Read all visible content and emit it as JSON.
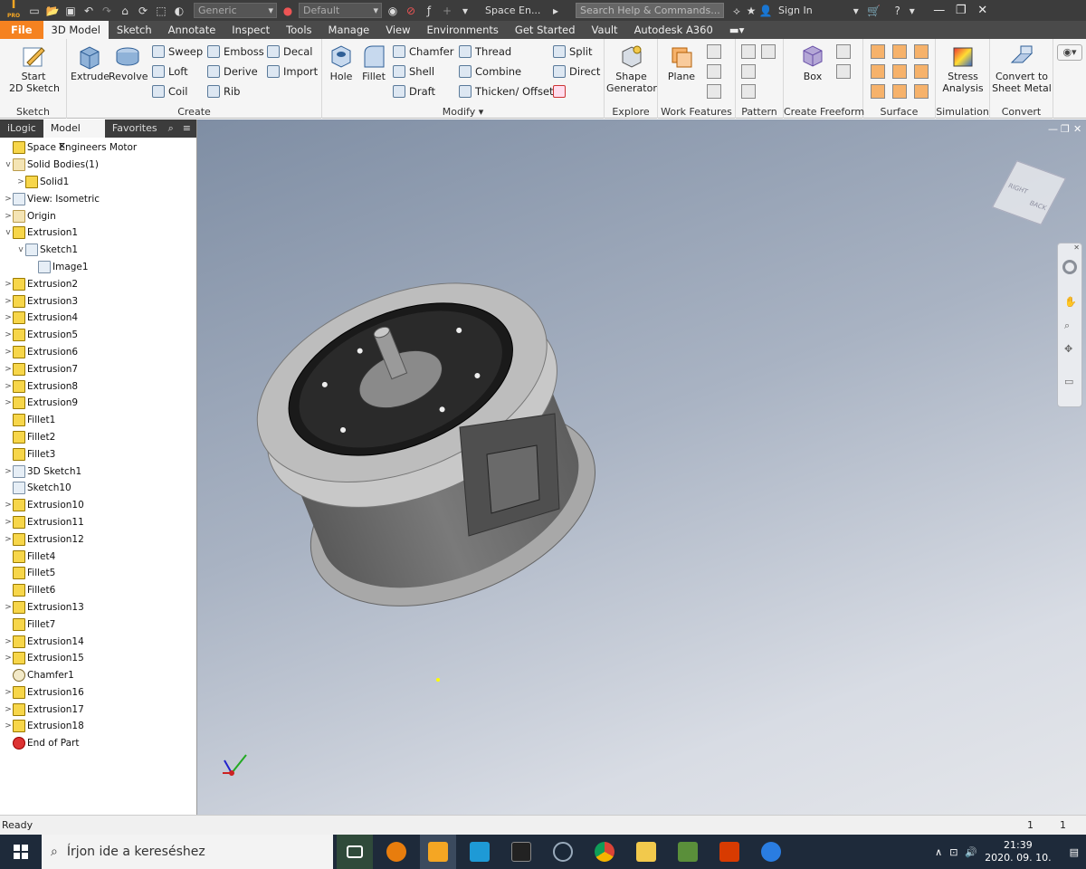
{
  "titlebar": {
    "app_badge": "PRO",
    "material_value": "Generic",
    "appearance_value": "Default",
    "doc_title": "Space En...",
    "search_placeholder": "Search Help & Commands...",
    "signin": "Sign In"
  },
  "tabs": [
    "File",
    "3D Model",
    "Sketch",
    "Annotate",
    "Inspect",
    "Tools",
    "Manage",
    "View",
    "Environments",
    "Get Started",
    "Vault",
    "Autodesk A360"
  ],
  "active_tab": "3D Model",
  "ribbon": {
    "sketch": {
      "title": "Sketch",
      "start_line1": "Start",
      "start_line2": "2D Sketch"
    },
    "create": {
      "title": "Create",
      "extrude": "Extrude",
      "revolve": "Revolve",
      "sweep": "Sweep",
      "loft": "Loft",
      "coil": "Coil",
      "emboss": "Emboss",
      "derive": "Derive",
      "rib": "Rib",
      "decal": "Decal",
      "import": "Import"
    },
    "modify": {
      "title": "Modify",
      "hole": "Hole",
      "fillet": "Fillet",
      "chamfer": "Chamfer",
      "shell": "Shell",
      "draft": "Draft",
      "thread": "Thread",
      "combine": "Combine",
      "thicken": "Thicken/ Offset",
      "split": "Split",
      "direct": "Direct"
    },
    "explore": {
      "title": "Explore",
      "shape_line1": "Shape",
      "shape_line2": "Generator"
    },
    "work": {
      "title": "Work Features",
      "plane": "Plane"
    },
    "pattern": {
      "title": "Pattern"
    },
    "freeform": {
      "title": "Create Freeform",
      "box": "Box"
    },
    "surface": {
      "title": "Surface"
    },
    "simulation": {
      "title": "Simulation",
      "stress_line1": "Stress",
      "stress_line2": "Analysis"
    },
    "convert": {
      "title": "Convert",
      "sm_line1": "Convert to",
      "sm_line2": "Sheet Metal"
    }
  },
  "browser": {
    "tabs": [
      "iLogic",
      "Model",
      "Favorites"
    ],
    "tree": [
      {
        "label": "Space Engineers Motor",
        "indent": 0,
        "exp": "",
        "icon": "part"
      },
      {
        "label": "Solid Bodies(1)",
        "indent": 0,
        "exp": "v",
        "icon": "fold"
      },
      {
        "label": "Solid1",
        "indent": 1,
        "exp": ">",
        "icon": "part"
      },
      {
        "label": "View: Isometric",
        "indent": 0,
        "exp": ">",
        "icon": "sk"
      },
      {
        "label": "Origin",
        "indent": 0,
        "exp": ">",
        "icon": "fold"
      },
      {
        "label": "Extrusion1",
        "indent": 0,
        "exp": "v",
        "icon": "part"
      },
      {
        "label": "Sketch1",
        "indent": 1,
        "exp": "v",
        "icon": "sk"
      },
      {
        "label": "Image1",
        "indent": 2,
        "exp": "",
        "icon": "sk"
      },
      {
        "label": "Extrusion2",
        "indent": 0,
        "exp": ">",
        "icon": "part"
      },
      {
        "label": "Extrusion3",
        "indent": 0,
        "exp": ">",
        "icon": "part"
      },
      {
        "label": "Extrusion4",
        "indent": 0,
        "exp": ">",
        "icon": "part"
      },
      {
        "label": "Extrusion5",
        "indent": 0,
        "exp": ">",
        "icon": "part"
      },
      {
        "label": "Extrusion6",
        "indent": 0,
        "exp": ">",
        "icon": "part"
      },
      {
        "label": "Extrusion7",
        "indent": 0,
        "exp": ">",
        "icon": "part"
      },
      {
        "label": "Extrusion8",
        "indent": 0,
        "exp": ">",
        "icon": "part"
      },
      {
        "label": "Extrusion9",
        "indent": 0,
        "exp": ">",
        "icon": "part"
      },
      {
        "label": "Fillet1",
        "indent": 0,
        "exp": "",
        "icon": "part"
      },
      {
        "label": "Fillet2",
        "indent": 0,
        "exp": "",
        "icon": "part"
      },
      {
        "label": "Fillet3",
        "indent": 0,
        "exp": "",
        "icon": "part"
      },
      {
        "label": "3D Sketch1",
        "indent": 0,
        "exp": ">",
        "icon": "sk"
      },
      {
        "label": "Sketch10",
        "indent": 0,
        "exp": "",
        "icon": "sk"
      },
      {
        "label": "Extrusion10",
        "indent": 0,
        "exp": ">",
        "icon": "part"
      },
      {
        "label": "Extrusion11",
        "indent": 0,
        "exp": ">",
        "icon": "part"
      },
      {
        "label": "Extrusion12",
        "indent": 0,
        "exp": ">",
        "icon": "part"
      },
      {
        "label": "Fillet4",
        "indent": 0,
        "exp": "",
        "icon": "part"
      },
      {
        "label": "Fillet5",
        "indent": 0,
        "exp": "",
        "icon": "part"
      },
      {
        "label": "Fillet6",
        "indent": 0,
        "exp": "",
        "icon": "part"
      },
      {
        "label": "Extrusion13",
        "indent": 0,
        "exp": ">",
        "icon": "part"
      },
      {
        "label": "Fillet7",
        "indent": 0,
        "exp": "",
        "icon": "part"
      },
      {
        "label": "Extrusion14",
        "indent": 0,
        "exp": ">",
        "icon": "part"
      },
      {
        "label": "Extrusion15",
        "indent": 0,
        "exp": ">",
        "icon": "part"
      },
      {
        "label": "Chamfer1",
        "indent": 0,
        "exp": "",
        "icon": "ch"
      },
      {
        "label": "Extrusion16",
        "indent": 0,
        "exp": ">",
        "icon": "part"
      },
      {
        "label": "Extrusion17",
        "indent": 0,
        "exp": ">",
        "icon": "part"
      },
      {
        "label": "Extrusion18",
        "indent": 0,
        "exp": ">",
        "icon": "part"
      },
      {
        "label": "End of Part",
        "indent": 0,
        "exp": "",
        "icon": "end"
      }
    ]
  },
  "viewcube": {
    "right": "RIGHT",
    "back": "BACK"
  },
  "status": {
    "text": "Ready",
    "count1": "1",
    "count2": "1"
  },
  "taskbar": {
    "search_placeholder": "Írjon ide a kereséshez",
    "time": "21:39",
    "date": "2020. 09. 10."
  }
}
